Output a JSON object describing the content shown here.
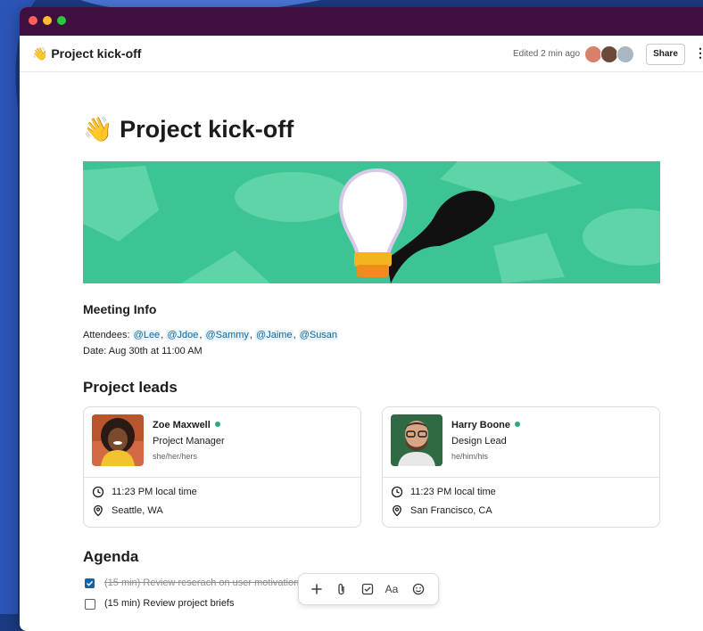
{
  "header": {
    "title": "Project kick-off",
    "edited": "Edited 2 min ago",
    "share_label": "Share",
    "more_label": "⋮"
  },
  "page": {
    "title": "Project kick-off",
    "title_icon": "waving-hand-icon"
  },
  "meeting": {
    "heading": "Meeting Info",
    "attendees_label": "Attendees:",
    "attendees": [
      "@Lee",
      "@Jdoe",
      "@Sammy",
      "@Jaime",
      "@Susan"
    ],
    "date": "Date: Aug 30th at 11:00 AM"
  },
  "leads": {
    "heading": "Project leads",
    "people": [
      {
        "name": "Zoe Maxwell",
        "role": "Project Manager",
        "pronouns": "she/her/hers",
        "time": "11:23 PM local time",
        "location": "Seattle, WA"
      },
      {
        "name": "Harry Boone",
        "role": "Design Lead",
        "pronouns": "he/him/his",
        "time": "11:23 PM local time",
        "location": "San Francisco, CA"
      }
    ]
  },
  "agenda": {
    "heading": "Agenda",
    "items": [
      {
        "text": "(15 min) Review reserach on user motivations",
        "checked": true
      },
      {
        "text": "(15 min) Review project briefs",
        "checked": false
      }
    ]
  },
  "toolbar": {
    "text_format_label": "Aa",
    "icons": [
      "plus-icon",
      "paperclip-icon",
      "checkbox-icon",
      "text-format-icon",
      "emoji-icon"
    ]
  },
  "colors": {
    "titlebar": "#3e0f3f",
    "banner_green": "#3cc495",
    "mention_blue": "#1264a3",
    "online_green": "#2bac76",
    "checkbox_blue": "#1264a3"
  }
}
